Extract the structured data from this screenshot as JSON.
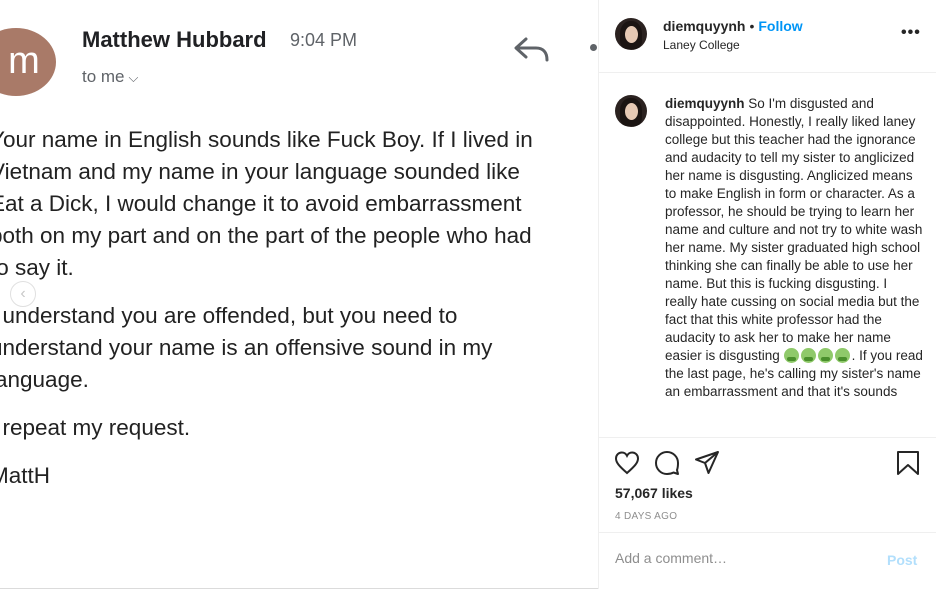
{
  "email": {
    "avatar_letter": "m",
    "sender": "Matthew Hubbard",
    "time": "9:04 PM",
    "to": "to me",
    "paragraphs": [
      [
        "Your name in English sounds like Fuck Boy. If I lived in",
        "Vietnam and my name in your language sounded like",
        "Eat a Dick, I would change it to avoid embarrassment",
        "both on my part and on the part of the people who had",
        "to say it."
      ],
      [
        "I understand you are offended, but you need to",
        "understand your name is an offensive sound in my",
        "language."
      ],
      [
        "I repeat my request."
      ],
      [
        "MattH"
      ]
    ]
  },
  "post": {
    "username": "diemquyynh",
    "follow_label": "Follow",
    "location": "Laney College",
    "more": "•••",
    "caption_user": "diemquyynh",
    "caption_before_emoji": "So I'm disgusted and disappointed. Honestly, I really liked laney college but this teacher had the ignorance and audacity to tell my sister to anglicized her name is disgusting. Anglicized means to make English in form or character. As a professor, he should be trying to learn her name and culture and not try to white wash her name. My sister graduated high school thinking she can finally be able to use her name. But this is fucking disgusting. I really hate cussing on social media but the fact that this white professor had the audacity to ask her to make her name easier is disgusting",
    "caption_emoji_count": 4,
    "caption_after_emoji": ". If you read the last page, he's calling my sister's name an embarrassment and that it's sounds",
    "likes": "57,067 likes",
    "time_ago": "4 DAYS AGO",
    "comment_placeholder": "Add a comment…",
    "post_label": "Post"
  },
  "icons": [
    "back-arrow-icon",
    "heart-icon",
    "comment-icon",
    "share-icon",
    "bookmark-icon",
    "chevron-down-icon",
    "reply-icon",
    "more-icon"
  ]
}
